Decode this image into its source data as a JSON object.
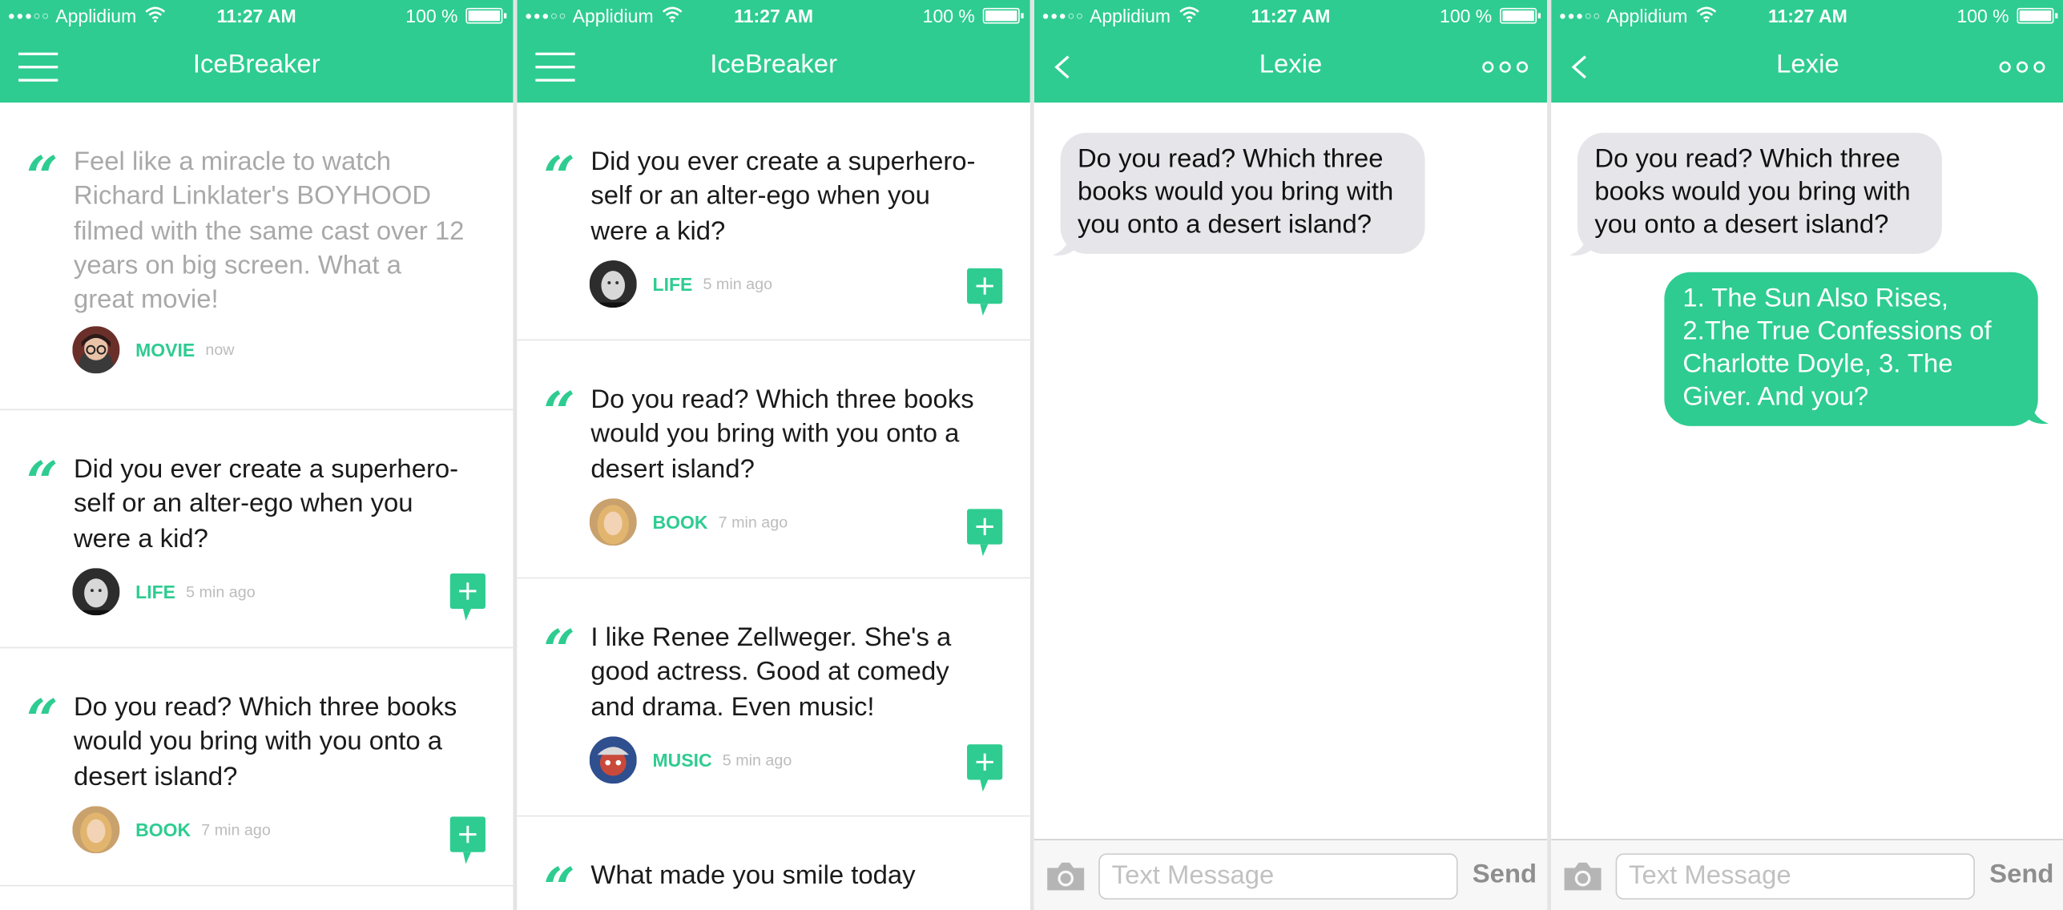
{
  "status_bar": {
    "signal": "●●●○○",
    "carrier": "Applidium",
    "time": "11:27 AM",
    "battery": "100 %",
    "battery_level": 1.0
  },
  "colors": {
    "accent": "#2ecc91",
    "incoming_bubble": "#e5e5ea",
    "divider": "#e6e6e6"
  },
  "feed": {
    "title": "IceBreaker",
    "menu_icon": "hamburger-menu-icon",
    "add_icon": "add-comment-icon",
    "cards": [
      {
        "text": "Feel like a miracle to watch Richard Linklater's BOYHOOD filmed with the same cast over 12 years on big screen. What a great movie!",
        "category": "MOVIE",
        "time": "now",
        "read": true
      },
      {
        "text": "Did you ever create a superhero-self or an alter-ego when you were a kid?",
        "category": "LIFE",
        "time": "5 min ago"
      },
      {
        "text": "Do you read? Which three books would you bring with you onto a desert island?",
        "category": "BOOK",
        "time": "7 min ago"
      },
      {
        "text": "I like Renee Zellweger. She's a good actress. Good at comedy and drama. Even music!",
        "category": "MUSIC",
        "time": "5 min ago"
      },
      {
        "text": "What made you smile today"
      }
    ]
  },
  "chat": {
    "title": "Lexie",
    "back_icon": "chevron-left-icon",
    "more_icon": "more-dots-icon",
    "messages": [
      {
        "from": "them",
        "text": "Do you read? Which three books would you bring with you onto a desert island?"
      },
      {
        "from": "me",
        "text": "1. The Sun Also Rises, 2.The True Confessions of Charlotte Doyle, 3. The Giver. And you?"
      }
    ],
    "input_placeholder": "Text Message",
    "send_label": "Send",
    "camera_icon": "camera-icon"
  }
}
